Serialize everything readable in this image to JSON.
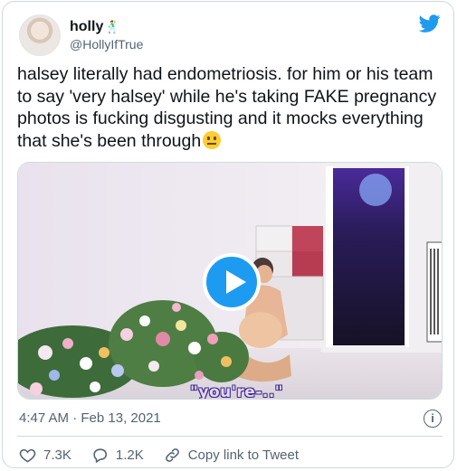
{
  "author": {
    "display_name": "holly",
    "name_emoji": "🕺",
    "handle": "@HollyIfTrue"
  },
  "tweet": {
    "text": "halsey literally had endometriosis. for him or his team to say 'very halsey' while he's taking FAKE pregnancy photos is fucking disgusting and it mocks everything that she's been through"
  },
  "video": {
    "caption": "\"you're-..\""
  },
  "meta": {
    "timestamp": "4:47 AM · Feb 13, 2021"
  },
  "actions": {
    "likes": "7.3K",
    "replies": "1.2K",
    "copy_link": "Copy link to Tweet"
  },
  "colors": {
    "accent": "#1d9bf0",
    "secondary_text": "#536471",
    "border": "#cfd9de"
  },
  "icons": [
    "twitter-bird-icon",
    "play-icon",
    "info-icon",
    "heart-icon",
    "reply-icon",
    "link-icon",
    "neutral-face-emoji"
  ]
}
